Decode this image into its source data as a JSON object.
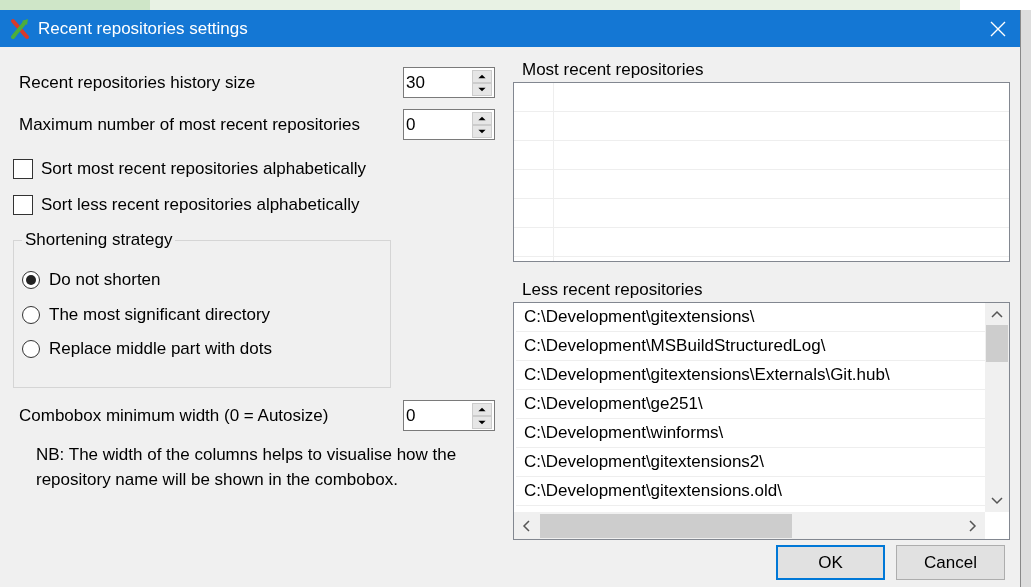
{
  "window": {
    "title": "Recent repositories settings"
  },
  "spinners": [
    {
      "label": "Recent repositories history size",
      "value": "30"
    },
    {
      "label": "Maximum number of most recent repositories",
      "value": "0"
    }
  ],
  "checkboxes": [
    {
      "label": "Sort most recent repositories alphabetically",
      "checked": false
    },
    {
      "label": "Sort less recent repositories alphabetically",
      "checked": false
    }
  ],
  "shortening": {
    "title": "Shortening strategy",
    "options": [
      {
        "label": "Do not shorten",
        "selected": true
      },
      {
        "label": "The most significant directory",
        "selected": false
      },
      {
        "label": "Replace middle part with dots",
        "selected": false
      }
    ]
  },
  "combobox_width": {
    "label": "Combobox minimum width (0 = Autosize)",
    "value": "0"
  },
  "note": "NB: The width of the columns helps to visualise how the repository name will be shown in the combobox.",
  "most_recent": {
    "label": "Most recent repositories"
  },
  "less_recent": {
    "label": "Less recent repositories",
    "rows": [
      "C:\\Development\\gitextensions\\",
      "C:\\Development\\MSBuildStructuredLog\\",
      "C:\\Development\\gitextensions\\Externals\\Git.hub\\",
      "C:\\Development\\ge251\\",
      "C:\\Development\\winforms\\",
      "C:\\Development\\gitextensions2\\",
      "C:\\Development\\gitextensions.old\\"
    ]
  },
  "buttons": [
    {
      "label": "OK",
      "default": true
    },
    {
      "label": "Cancel",
      "default": false
    }
  ]
}
